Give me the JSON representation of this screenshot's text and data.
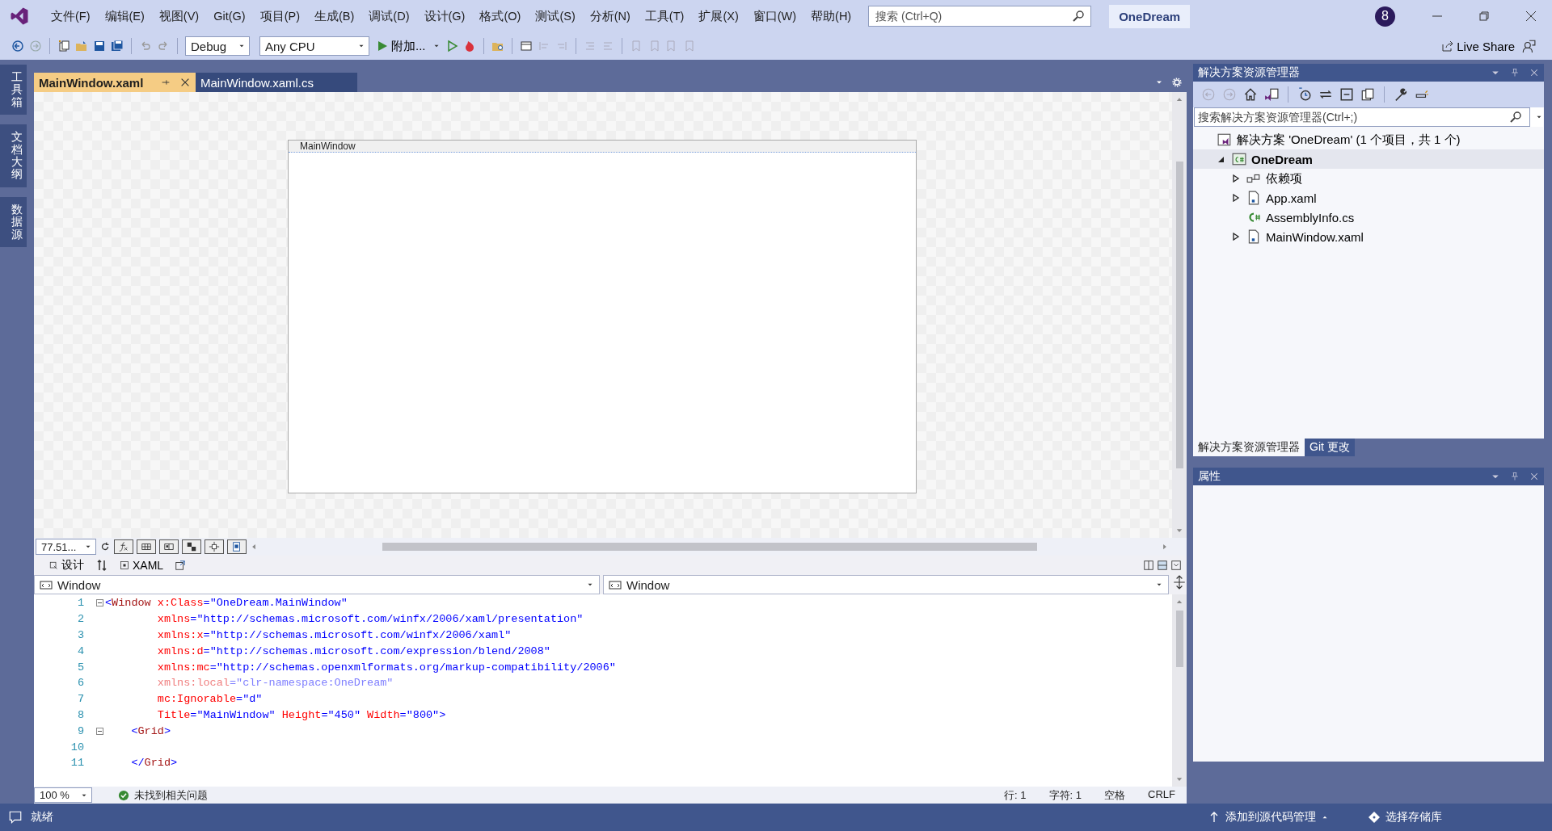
{
  "menu": [
    "文件(F)",
    "编辑(E)",
    "视图(V)",
    "Git(G)",
    "项目(P)",
    "生成(B)",
    "调试(D)",
    "设计(G)",
    "格式(O)",
    "测试(S)",
    "分析(N)",
    "工具(T)",
    "扩展(X)",
    "窗口(W)",
    "帮助(H)"
  ],
  "search": {
    "placeholder": "搜索 (Ctrl+Q)"
  },
  "solution_title": "OneDream",
  "notification_count": "8",
  "toolbar": {
    "configuration": "Debug",
    "platform": "Any CPU",
    "attach": "附加...",
    "live_share": "Live Share"
  },
  "side_tabs": [
    "工具箱",
    "文档大纲",
    "数据源"
  ],
  "doc_tabs": [
    {
      "label": "MainWindow.xaml",
      "selected": true
    },
    {
      "label": "MainWindow.xaml.cs",
      "selected": false
    }
  ],
  "designer": {
    "window_title": "MainWindow",
    "zoom": "77.51...",
    "view_tabs": [
      {
        "label": "设计",
        "selected": false
      },
      {
        "label": "XAML",
        "selected": false
      }
    ]
  },
  "editor": {
    "left_scope": "Window",
    "right_scope": "Window",
    "lines": [
      {
        "number": "1",
        "foldable": true,
        "faded": false,
        "tokens": [
          {
            "text": "<",
            "kind": "punct"
          },
          {
            "text": "Window",
            "kind": "element"
          },
          {
            "text": " x:Class",
            "kind": "attr"
          },
          {
            "text": "=\"OneDream.MainWindow\"",
            "kind": "value"
          }
        ]
      },
      {
        "number": "2",
        "foldable": false,
        "faded": false,
        "tokens": [
          {
            "text": "        xmlns",
            "kind": "attr"
          },
          {
            "text": "=\"http://schemas.microsoft.com/winfx/2006/xaml/presentation\"",
            "kind": "value"
          }
        ]
      },
      {
        "number": "3",
        "foldable": false,
        "faded": false,
        "tokens": [
          {
            "text": "        xmlns:x",
            "kind": "attr"
          },
          {
            "text": "=\"http://schemas.microsoft.com/winfx/2006/xaml\"",
            "kind": "value"
          }
        ]
      },
      {
        "number": "4",
        "foldable": false,
        "faded": false,
        "tokens": [
          {
            "text": "        xmlns:d",
            "kind": "attr"
          },
          {
            "text": "=\"http://schemas.microsoft.com/expression/blend/2008\"",
            "kind": "value"
          }
        ]
      },
      {
        "number": "5",
        "foldable": false,
        "faded": false,
        "tokens": [
          {
            "text": "        xmlns:mc",
            "kind": "attr"
          },
          {
            "text": "=\"http://schemas.openxmlformats.org/markup-compatibility/2006\"",
            "kind": "value"
          }
        ]
      },
      {
        "number": "6",
        "foldable": false,
        "faded": true,
        "tokens": [
          {
            "text": "        xmlns:local",
            "kind": "attr"
          },
          {
            "text": "=\"clr-namespace:OneDream\"",
            "kind": "value"
          }
        ]
      },
      {
        "number": "7",
        "foldable": false,
        "faded": false,
        "tokens": [
          {
            "text": "        mc:Ignorable",
            "kind": "attr"
          },
          {
            "text": "=\"d\"",
            "kind": "value"
          }
        ]
      },
      {
        "number": "8",
        "foldable": false,
        "faded": false,
        "tokens": [
          {
            "text": "        Title",
            "kind": "attr"
          },
          {
            "text": "=\"MainWindow\"",
            "kind": "value"
          },
          {
            "text": " Height",
            "kind": "attr"
          },
          {
            "text": "=\"450\"",
            "kind": "value"
          },
          {
            "text": " Width",
            "kind": "attr"
          },
          {
            "text": "=\"800\"",
            "kind": "value"
          },
          {
            "text": ">",
            "kind": "punct"
          }
        ]
      },
      {
        "number": "9",
        "foldable": true,
        "faded": false,
        "tokens": [
          {
            "text": "    <",
            "kind": "punct"
          },
          {
            "text": "Grid",
            "kind": "element"
          },
          {
            "text": ">",
            "kind": "punct"
          }
        ]
      },
      {
        "number": "10",
        "foldable": false,
        "faded": false
      },
      {
        "number": "11",
        "foldable": false,
        "faded": false,
        "tokens": [
          {
            "text": "    </",
            "kind": "punct"
          },
          {
            "text": "Grid",
            "kind": "element"
          },
          {
            "text": ">",
            "kind": "punct"
          }
        ]
      }
    ],
    "status": {
      "zoom": "100 %",
      "issues": "未找到相关问题",
      "line": "行: 1",
      "char": "字符: 1",
      "whitespace": "空格",
      "line_ending": "CRLF"
    }
  },
  "solution_explorer": {
    "title": "解决方案资源管理器",
    "placeholder": "搜索解决方案资源管理器(Ctrl+;)",
    "tree": [
      {
        "label": "解决方案 'OneDream' (1 个项目，共 1 个)",
        "kind": "solution",
        "expandable": false,
        "expanded": true,
        "selected": false,
        "children": [
          {
            "label": "OneDream",
            "kind": "project",
            "expandable": true,
            "expanded": true,
            "selected": true,
            "children": [
              {
                "label": "依赖项",
                "kind": "dependencies",
                "expandable": true,
                "expanded": false,
                "selected": false
              },
              {
                "label": "App.xaml",
                "kind": "xaml",
                "expandable": true,
                "expanded": false,
                "selected": false
              },
              {
                "label": "AssemblyInfo.cs",
                "kind": "cs",
                "expandable": false,
                "expanded": false,
                "selected": false
              },
              {
                "label": "MainWindow.xaml",
                "kind": "xaml",
                "expandable": true,
                "expanded": false,
                "selected": false
              }
            ]
          }
        ]
      }
    ],
    "tabs": [
      {
        "label": "解决方案资源管理器",
        "selected": true
      },
      {
        "label": "Git 更改",
        "selected": false
      }
    ]
  },
  "properties": {
    "title": "属性"
  },
  "status_bar": {
    "ready": "就绪",
    "add_source_control": "添加到源代码管理",
    "select_repo": "选择存储库"
  }
}
